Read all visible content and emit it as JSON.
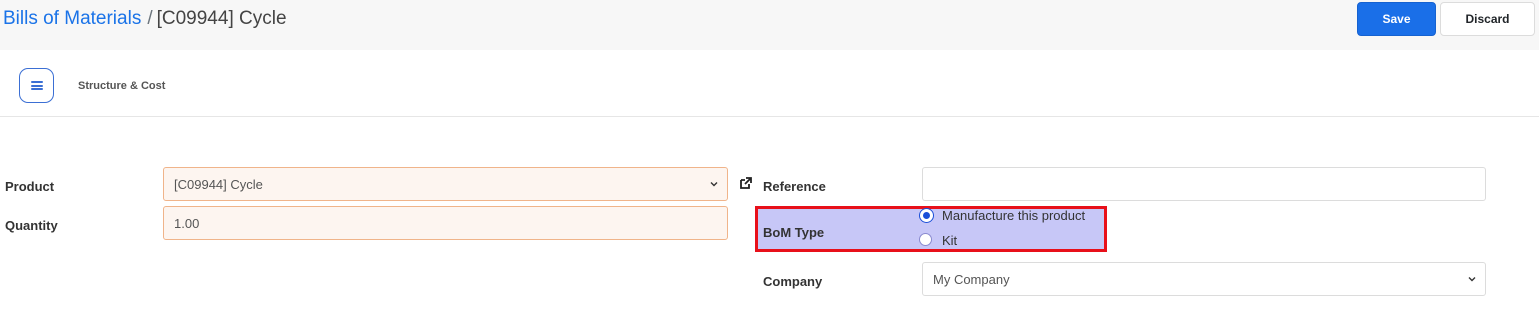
{
  "breadcrumb": {
    "parent": "Bills of Materials",
    "separator": "/",
    "current": "[C09944] Cycle"
  },
  "actions": {
    "save": "Save",
    "discard": "Discard"
  },
  "smart_buttons": {
    "structure_cost": "Structure & Cost"
  },
  "form": {
    "product_label": "Product",
    "product_value": "[C09944] Cycle",
    "quantity_label": "Quantity",
    "quantity_value": "1.00",
    "reference_label": "Reference",
    "reference_value": "",
    "bom_type_label": "BoM Type",
    "bom_type_options": [
      "Manufacture this product",
      "Kit"
    ],
    "bom_type_selected": "Manufacture this product",
    "company_label": "Company",
    "company_value": "My Company"
  },
  "colors": {
    "accent": "#1a6fe8",
    "link": "#1a73e8",
    "highlight_fill": "#c7c7f7",
    "highlight_border": "#e8101a",
    "required_bg": "#fdf5f0",
    "required_border": "#f0b48a"
  },
  "icons": {
    "menu": "list-icon",
    "external": "external-link-icon",
    "dropdown": "chevron-down-icon"
  }
}
